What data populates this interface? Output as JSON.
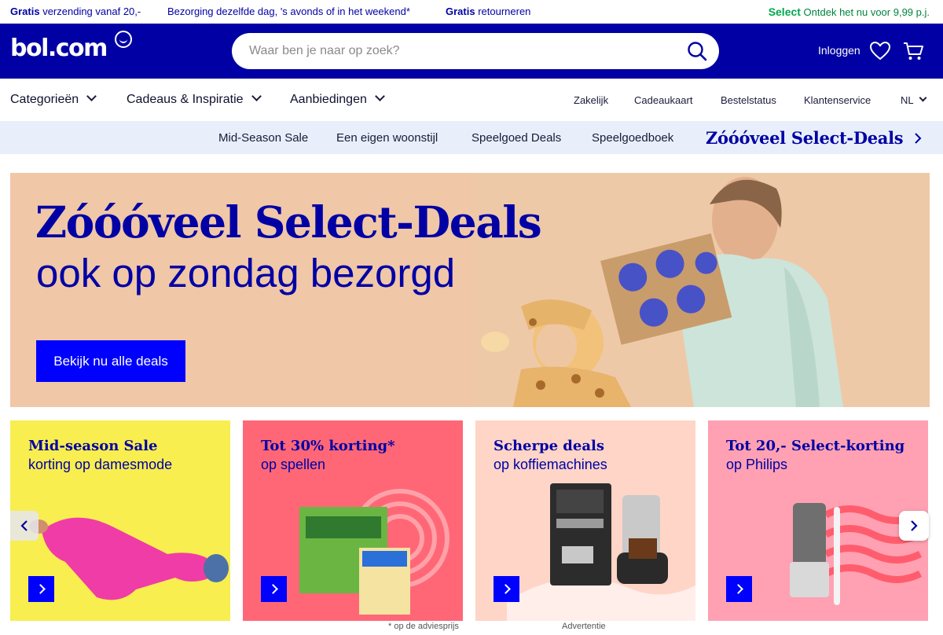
{
  "usp": {
    "item1_bold": "Gratis",
    "item1_text": " verzending vanaf 20,-",
    "item2_text": "Bezorging dezelfde dag, 's avonds of in het weekend*",
    "item3_bold": "Gratis",
    "item3_text": " retourneren",
    "select_bold": "Select",
    "select_text": " Ontdek het nu voor 9,99 p.j."
  },
  "header": {
    "logo": "bol.com",
    "search_placeholder": "Waar ben je naar op zoek?",
    "login_label": "Inloggen"
  },
  "nav": {
    "left": [
      "Categorieën",
      "Cadeaus & Inspiratie",
      "Aanbiedingen"
    ],
    "right": [
      "Zakelijk",
      "Cadeaukaart",
      "Bestelstatus",
      "Klantenservice",
      "NL"
    ]
  },
  "subnav": {
    "items": [
      "Mid-Season Sale",
      "Een eigen woonstijl",
      "Speelgoed Deals",
      "Speelgoedboek"
    ],
    "highlight": "Zóóóveel Select-Deals"
  },
  "hero": {
    "title": "Zóóóveel Select-Deals",
    "subtitle": "ook op zondag bezorgd",
    "button_label": "Bekijk nu alle deals"
  },
  "cards": [
    {
      "title": "Mid-season Sale",
      "subtitle": "korting op damesmode"
    },
    {
      "title": "Tot 30% korting*",
      "subtitle": "op spellen"
    },
    {
      "title": "Scherpe deals",
      "subtitle": "op koffiemachines"
    },
    {
      "title": "Tot 20,- Select-korting",
      "subtitle": "op Philips"
    }
  ],
  "footnotes": {
    "advice_price": "* op de adviesprijs",
    "ad_label": "Advertentie"
  },
  "colors": {
    "brand_blue": "#0000a4",
    "cta_blue": "#0000ff",
    "select_green": "#00a84f"
  }
}
